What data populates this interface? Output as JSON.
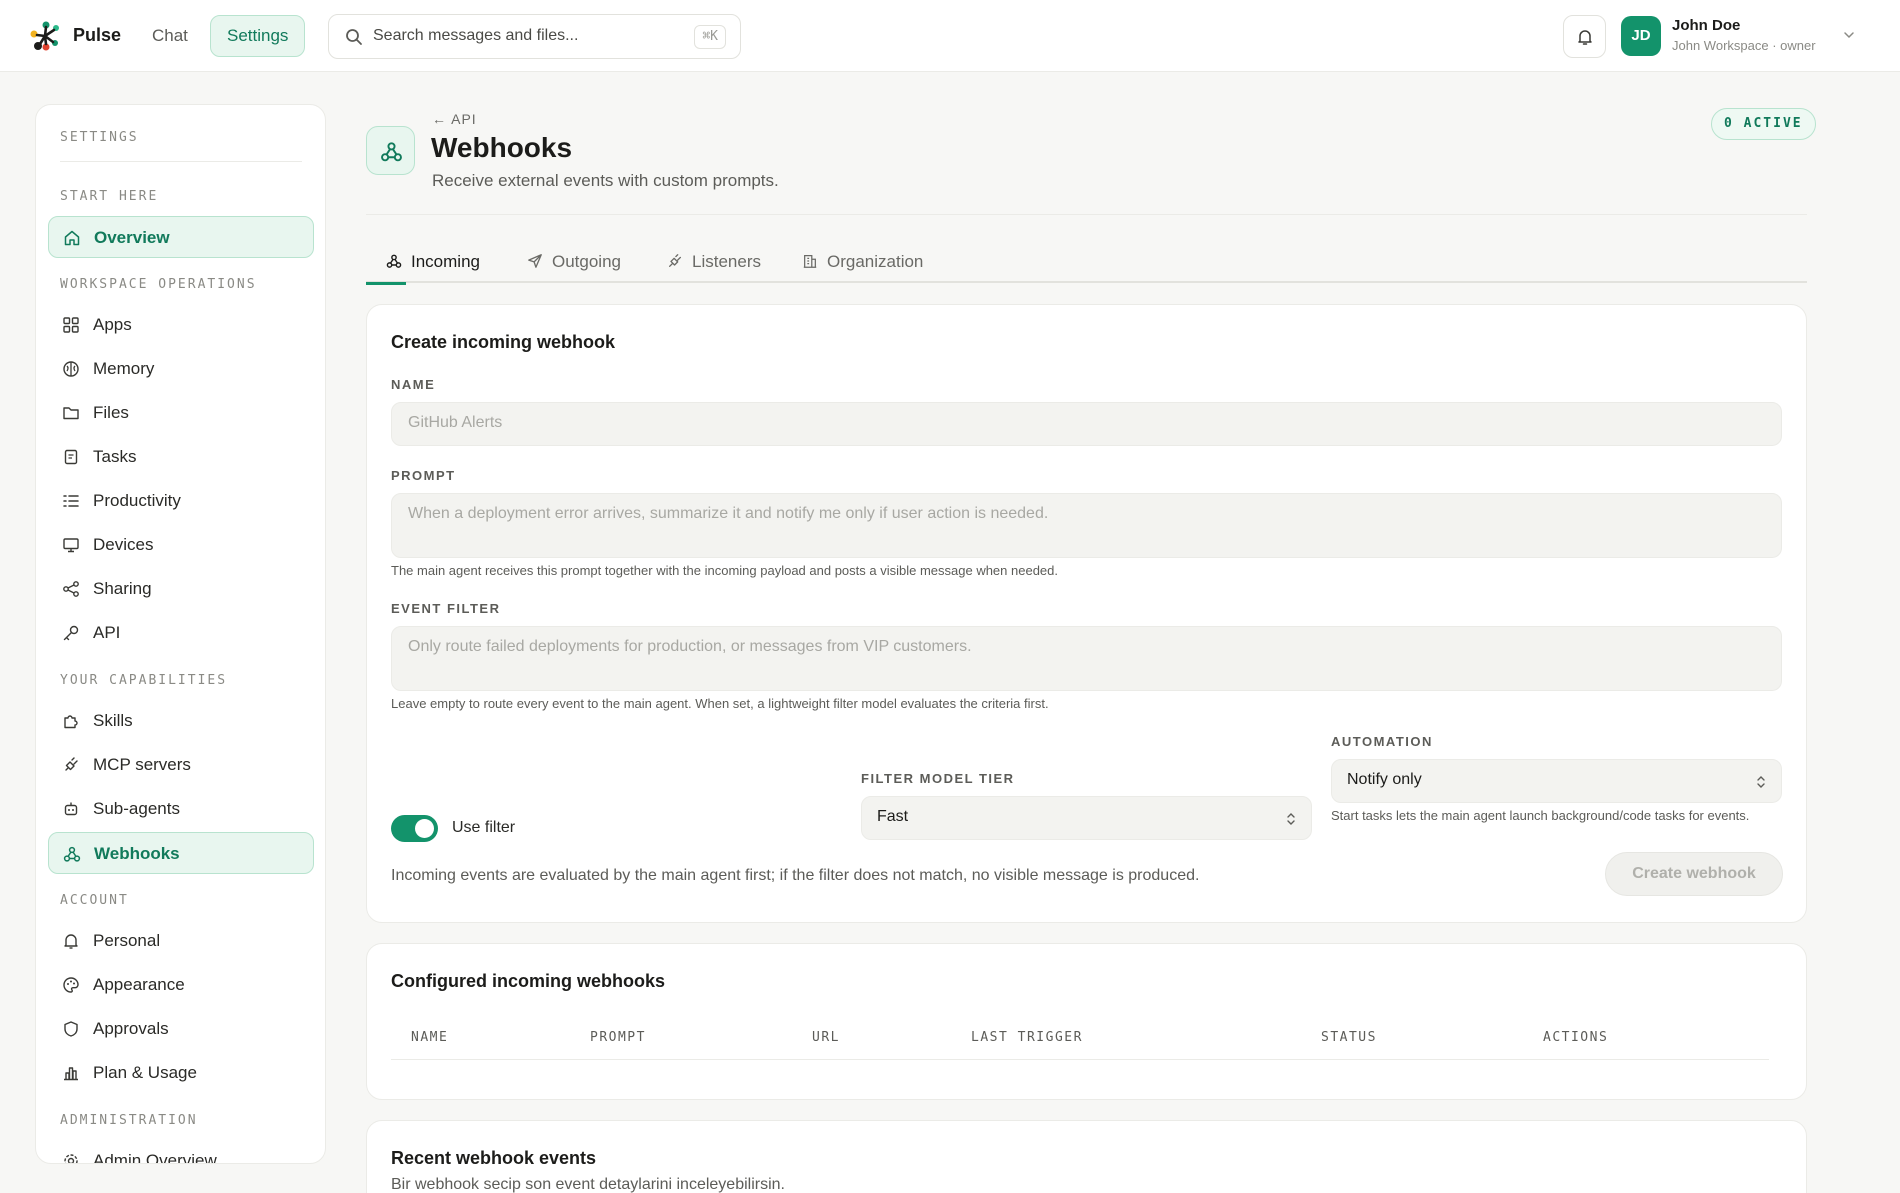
{
  "app": {
    "name": "Pulse"
  },
  "nav": {
    "chat": "Chat",
    "settings": "Settings"
  },
  "search": {
    "placeholder": "Search messages and files...",
    "shortcut": "⌘K"
  },
  "user": {
    "initials": "JD",
    "name": "John Doe",
    "workspace": "John Workspace · owner"
  },
  "colors": {
    "accent": "#13936b",
    "accent_bg": "#e8f6ef",
    "accent_border": "#b8e3cf"
  },
  "sidebar": {
    "title": "SETTINGS",
    "sections": {
      "start": "START HERE",
      "workspace": "WORKSPACE OPERATIONS",
      "capabilities": "YOUR CAPABILITIES",
      "account": "ACCOUNT",
      "admin": "ADMINISTRATION"
    },
    "items": {
      "overview": {
        "label": "Overview",
        "icon": "home-icon"
      },
      "apps": {
        "label": "Apps",
        "icon": "apps-icon"
      },
      "memory": {
        "label": "Memory",
        "icon": "brain-icon"
      },
      "files": {
        "label": "Files",
        "icon": "folder-icon"
      },
      "tasks": {
        "label": "Tasks",
        "icon": "clipboard-icon"
      },
      "productivity": {
        "label": "Productivity",
        "icon": "list-check-icon"
      },
      "devices": {
        "label": "Devices",
        "icon": "monitor-icon"
      },
      "sharing": {
        "label": "Sharing",
        "icon": "share-icon"
      },
      "api": {
        "label": "API",
        "icon": "key-icon"
      },
      "skills": {
        "label": "Skills",
        "icon": "puzzle-icon"
      },
      "mcp": {
        "label": "MCP servers",
        "icon": "plug-icon"
      },
      "subagents": {
        "label": "Sub-agents",
        "icon": "bot-icon"
      },
      "webhooks": {
        "label": "Webhooks",
        "icon": "webhook-icon"
      },
      "personal": {
        "label": "Personal",
        "icon": "bell-icon"
      },
      "appearance": {
        "label": "Appearance",
        "icon": "palette-icon"
      },
      "approvals": {
        "label": "Approvals",
        "icon": "shield-icon"
      },
      "plan": {
        "label": "Plan & Usage",
        "icon": "bar-chart-icon"
      },
      "admin_overview": {
        "label": "Admin Overview",
        "icon": "gear-icon"
      }
    }
  },
  "page": {
    "back": "API",
    "title": "Webhooks",
    "subtitle": "Receive external events with custom prompts.",
    "badge": "0 ACTIVE"
  },
  "tabs": {
    "incoming": "Incoming",
    "outgoing": "Outgoing",
    "listeners": "Listeners",
    "organization": "Organization"
  },
  "create": {
    "title": "Create incoming webhook",
    "name_label": "NAME",
    "name_placeholder": "GitHub Alerts",
    "prompt_label": "PROMPT",
    "prompt_placeholder": "When a deployment error arrives, summarize it and notify me only if user action is needed.",
    "prompt_help": "The main agent receives this prompt together with the incoming payload and posts a visible message when needed.",
    "filter_label": "EVENT FILTER",
    "filter_placeholder": "Only route failed deployments for production, or messages from VIP customers.",
    "filter_help": "Leave empty to route every event to the main agent. When set, a lightweight filter model evaluates the criteria first.",
    "use_filter": "Use filter",
    "tier_label": "FILTER MODEL TIER",
    "tier_value": "Fast",
    "automation_label": "AUTOMATION",
    "automation_value": "Notify only",
    "automation_help": "Start tasks lets the main agent launch background/code tasks for events.",
    "notice": "Incoming events are evaluated by the main agent first; if the filter does not match, no visible message is produced.",
    "button": "Create webhook"
  },
  "configured": {
    "title": "Configured incoming webhooks",
    "columns": [
      "NAME",
      "PROMPT",
      "URL",
      "LAST TRIGGER",
      "STATUS",
      "ACTIONS"
    ]
  },
  "recent": {
    "title": "Recent webhook events",
    "subtitle": "Bir webhook secip son event detaylarini inceleyebilirsin."
  }
}
